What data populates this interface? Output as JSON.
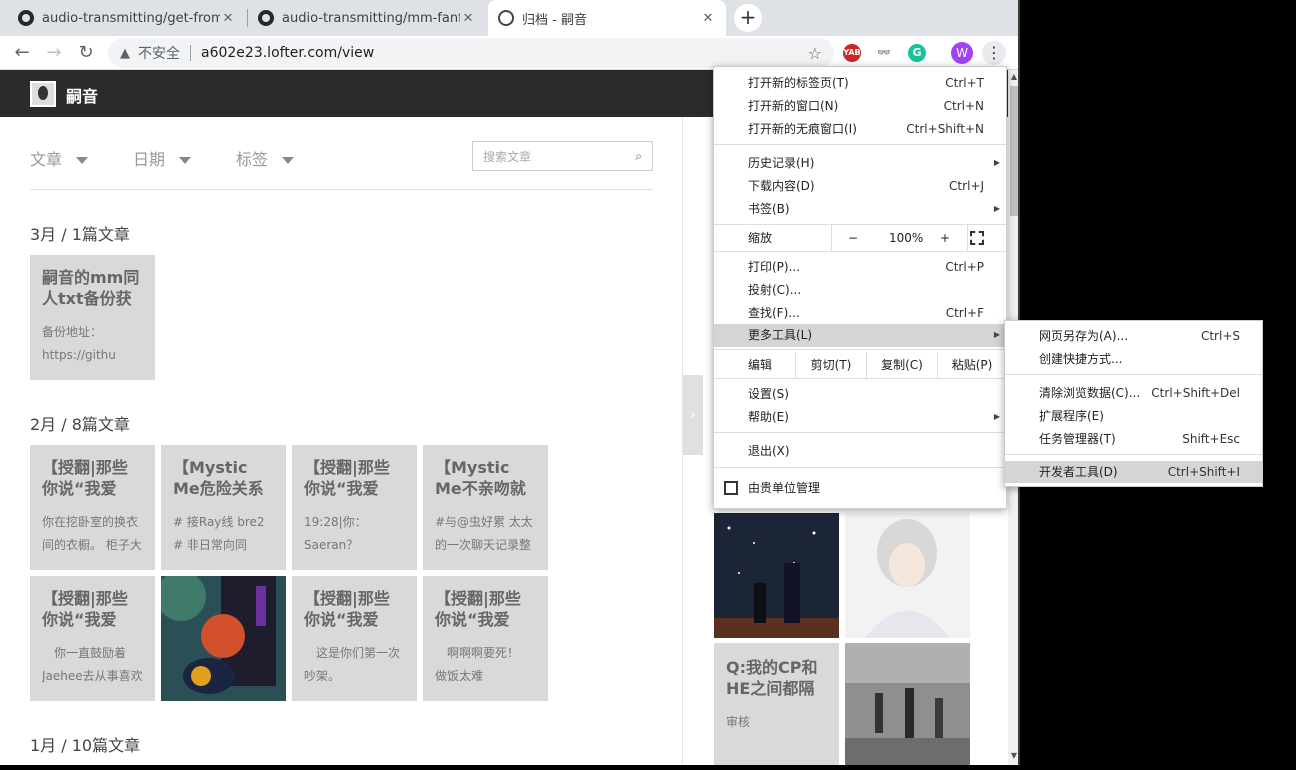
{
  "tabs": [
    {
      "title": "audio-transmitting/get-from-l",
      "close": "✕"
    },
    {
      "title": "audio-transmitting/mm-fanfic",
      "close": "✕"
    },
    {
      "title": "归档 - 嗣音",
      "close": "✕"
    }
  ],
  "newtab": "+",
  "toolbar": {
    "back": "←",
    "forward": "→",
    "reload": "↻",
    "warn_icon": "▲",
    "insecure_label": "不安全",
    "url": "a602e23.lofter.com/view",
    "star": "☆",
    "extensions": [
      "YAB",
      "👓",
      "G"
    ],
    "profile": "W",
    "menu": "⋮"
  },
  "site": {
    "name": "嗣音"
  },
  "filters": {
    "article": "文章",
    "date": "日期",
    "tags": "标签"
  },
  "search": {
    "placeholder": "搜索文章",
    "icon": "⌕"
  },
  "sections": [
    {
      "label": "3月 / 1篇文章"
    },
    {
      "label": "2月 / 8篇文章"
    },
    {
      "label": "1月 / 10篇文章"
    }
  ],
  "cards": [
    {
      "title": "嗣音的mm同人txt备份获",
      "excerpt": "备份地址： https://githu"
    },
    {
      "title": "【授翻|那些你说“我爱",
      "excerpt": "你在挖卧室的换衣间的衣橱。 柜子大"
    },
    {
      "title": "【Mystic Me危险关系",
      "excerpt": "# 接Ray线 bre2 # 非日常向同"
    },
    {
      "title": "【授翻|那些你说“我爱",
      "excerpt": "19:28|你： Saeran？ 19:30|S"
    },
    {
      "title": "【Mystic Me不亲吻就出不",
      "excerpt": "#与@虫好累 太太的一次聊天记录整"
    },
    {
      "title": "【授翻|那些你说“我爱",
      "excerpt": "　你一直鼓励着Jaehee去从事喜欢"
    },
    {
      "title": "",
      "excerpt": ""
    },
    {
      "title": "【授翻|那些你说“我爱",
      "excerpt": "　这是你们第一次吵架。"
    },
    {
      "title": "【授翻|那些你说“我爱",
      "excerpt": "　啊啊啊要死！　做饭太难"
    }
  ],
  "side_card": {
    "title": "Q:我的CP和HE之间都隔",
    "excerpt": "审核"
  },
  "side_tab": "›",
  "menu": {
    "new_tab": {
      "label": "打开新的标签页(T)",
      "shortcut": "Ctrl+T"
    },
    "new_window": {
      "label": "打开新的窗口(N)",
      "shortcut": "Ctrl+N"
    },
    "incognito": {
      "label": "打开新的无痕窗口(I)",
      "shortcut": "Ctrl+Shift+N"
    },
    "history": {
      "label": "历史记录(H)"
    },
    "downloads": {
      "label": "下载内容(D)",
      "shortcut": "Ctrl+J"
    },
    "bookmarks": {
      "label": "书签(B)"
    },
    "zoom": {
      "label": "缩放",
      "minus": "−",
      "value": "100%",
      "plus": "+"
    },
    "print": {
      "label": "打印(P)...",
      "shortcut": "Ctrl+P"
    },
    "cast": {
      "label": "投射(C)..."
    },
    "find": {
      "label": "查找(F)...",
      "shortcut": "Ctrl+F"
    },
    "more_tools": {
      "label": "更多工具(L)"
    },
    "edit": {
      "label": "编辑",
      "cut": "剪切(T)",
      "copy": "复制(C)",
      "paste": "粘贴(P)"
    },
    "settings": {
      "label": "设置(S)"
    },
    "help": {
      "label": "帮助(E)"
    },
    "exit": {
      "label": "退出(X)"
    },
    "managed": {
      "label": "由贵单位管理"
    },
    "submenu_arrow": "▶"
  },
  "submenu": {
    "save_page": {
      "label": "网页另存为(A)...",
      "shortcut": "Ctrl+S"
    },
    "shortcut": {
      "label": "创建快捷方式..."
    },
    "clear_data": {
      "label": "清除浏览数据(C)...",
      "shortcut": "Ctrl+Shift+Del"
    },
    "extensions": {
      "label": "扩展程序(E)"
    },
    "task_manager": {
      "label": "任务管理器(T)",
      "shortcut": "Shift+Esc"
    },
    "devtools": {
      "label": "开发者工具(D)",
      "shortcut": "Ctrl+Shift+I"
    }
  },
  "colors": {
    "header_bg": "#2b2b2b",
    "card_bg": "#d9d9d9",
    "menu_highlight": "#d5d5d5",
    "profile": "#a142f4"
  }
}
